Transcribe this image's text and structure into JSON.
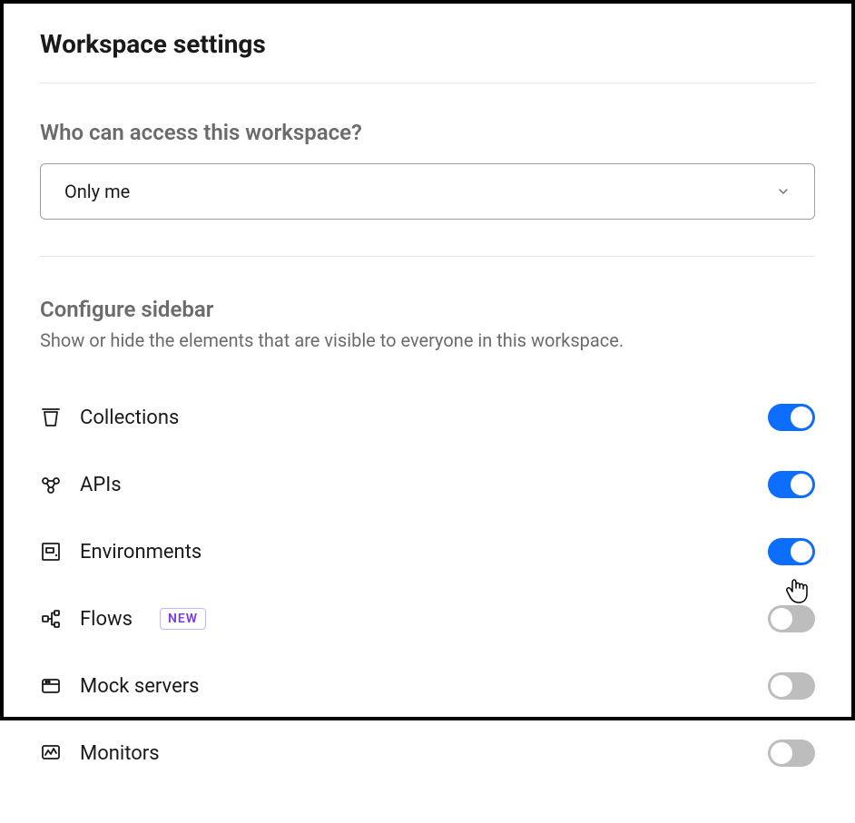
{
  "page_title": "Workspace settings",
  "access_section": {
    "header": "Who can access this workspace?",
    "selected_value": "Only me"
  },
  "sidebar_section": {
    "title": "Configure sidebar",
    "description": "Show or hide the elements that are visible to everyone in this workspace."
  },
  "sidebar_items": [
    {
      "label": "Collections",
      "enabled": true,
      "badge": null
    },
    {
      "label": "APIs",
      "enabled": true,
      "badge": null
    },
    {
      "label": "Environments",
      "enabled": true,
      "badge": null
    },
    {
      "label": "Flows",
      "enabled": false,
      "badge": "NEW"
    },
    {
      "label": "Mock servers",
      "enabled": false,
      "badge": null
    },
    {
      "label": "Monitors",
      "enabled": false,
      "badge": null
    }
  ]
}
